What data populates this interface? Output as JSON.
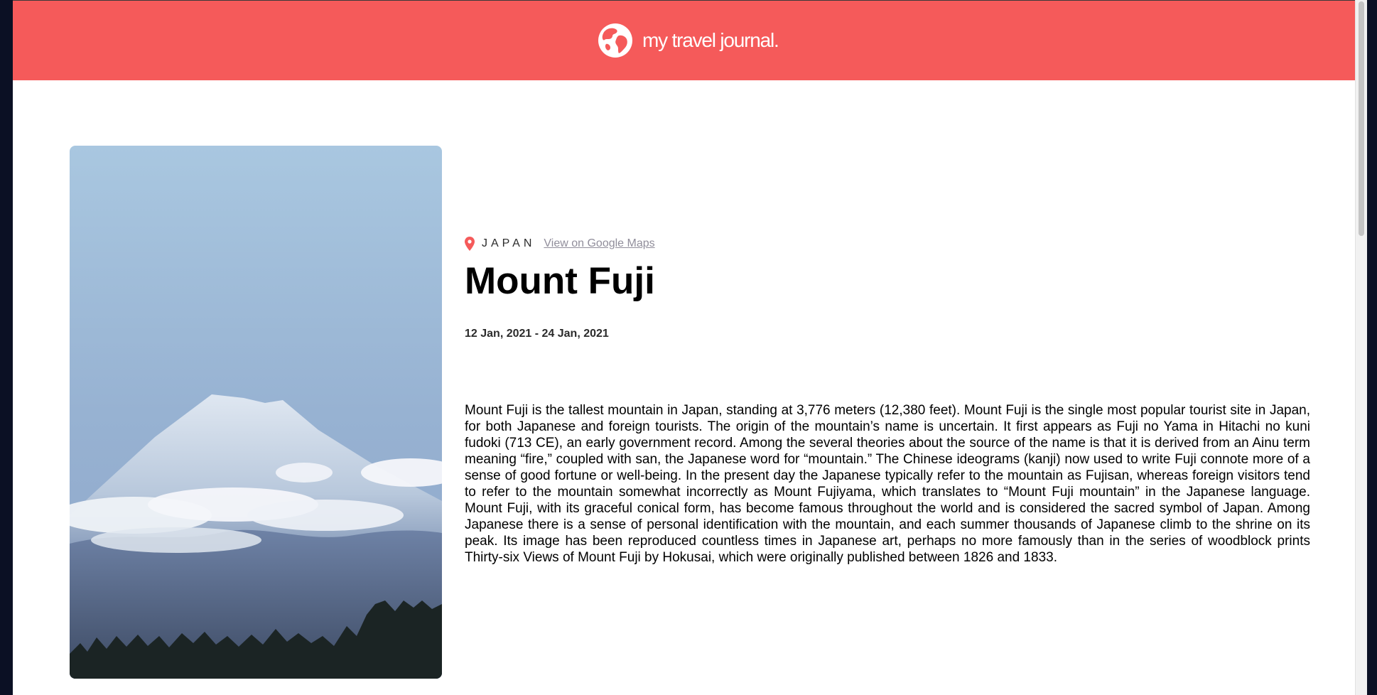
{
  "header": {
    "brand_name": "my travel journal.",
    "logo_icon": "globe-icon",
    "background_color": "#f55a5a"
  },
  "entry": {
    "image_alt": "Mount Fuji",
    "location_icon": "map-pin-icon",
    "location_color": "#f55a5a",
    "country": "JAPAN",
    "maps_link_label": "View on Google Maps",
    "title": "Mount Fuji",
    "dates": "12 Jan, 2021 - 24 Jan, 2021",
    "description": "Mount Fuji is the tallest mountain in Japan, standing at 3,776 meters (12,380 feet). Mount Fuji is the single most popular tourist site in Japan, for both Japanese and foreign tourists. The origin of the mountain’s name is uncertain. It first appears as Fuji no Yama in Hitachi no kuni fudoki (713 CE), an early government record. Among the several theories about the source of the name is that it is derived from an Ainu term meaning “fire,” coupled with san, the Japanese word for “mountain.” The Chinese ideograms (kanji) now used to write Fuji connote more of a sense of good fortune or well-being. In the present day the Japanese typically refer to the mountain as Fujisan, whereas foreign visitors tend to refer to the mountain somewhat incorrectly as Mount Fujiyama, which translates to “Mount Fuji mountain” in the Japanese language. Mount Fuji, with its graceful conical form, has become famous throughout the world and is considered the sacred symbol of Japan. Among Japanese there is a sense of personal identification with the mountain, and each summer thousands of Japanese climb to the shrine on its peak. Its image has been reproduced countless times in Japanese art, perhaps no more famously than in the series of woodblock prints Thirty-six Views of Mount Fuji by Hokusai, which were originally published between 1826 and 1833."
  }
}
